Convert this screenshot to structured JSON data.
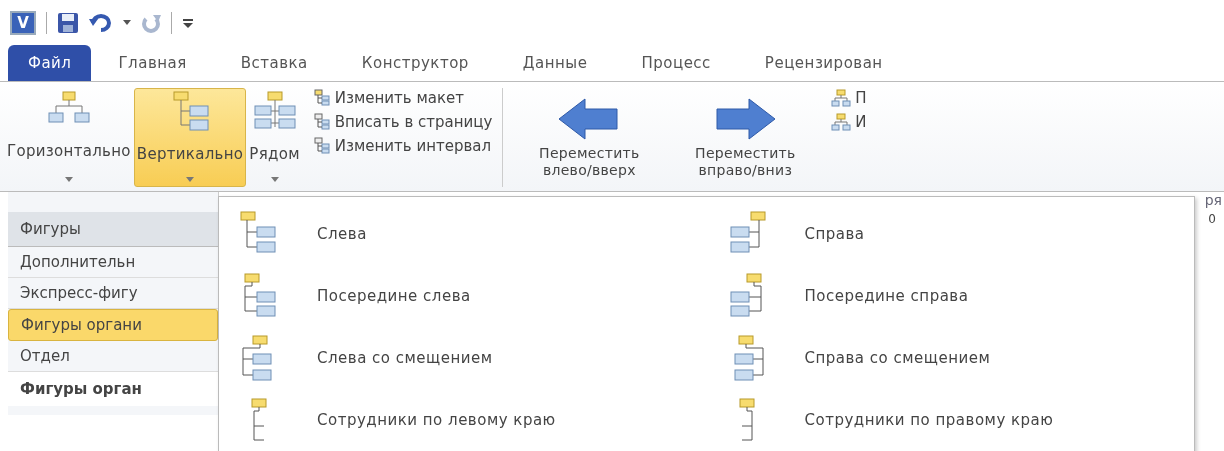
{
  "quick_access": {
    "logo": "V"
  },
  "tabs": [
    {
      "label": "Файл",
      "selected": true
    },
    {
      "label": "Главная",
      "selected": false
    },
    {
      "label": "Вставка",
      "selected": false
    },
    {
      "label": "Конструктор",
      "selected": false
    },
    {
      "label": "Данные",
      "selected": false
    },
    {
      "label": "Процесс",
      "selected": false
    },
    {
      "label": "Рецензирован",
      "selected": false
    }
  ],
  "ribbon": {
    "layout_buttons": [
      {
        "label": "Горизонтально",
        "selected": false,
        "kind": "horizontal"
      },
      {
        "label": "Вертикально",
        "selected": true,
        "kind": "vertical"
      },
      {
        "label": "Рядом",
        "selected": false,
        "kind": "side"
      }
    ],
    "small_buttons": [
      "Изменить макет",
      "Вписать в страницу",
      "Изменить интервал"
    ],
    "move_buttons": [
      {
        "label": "Переместить влево/вверх",
        "kind": "left"
      },
      {
        "label": "Переместить вправо/вниз",
        "kind": "right"
      }
    ],
    "cut_buttons": [
      "П",
      "И"
    ],
    "cut_group_label": "ря"
  },
  "ruler_fragment": "0",
  "shapes_pane": {
    "header": "Фигуры",
    "items": [
      {
        "label": "Дополнительн",
        "selected": false
      },
      {
        "label": "Экспресс-фигу",
        "selected": false
      },
      {
        "label": "Фигуры органи",
        "selected": true
      },
      {
        "label": "Отдел",
        "selected": false
      }
    ],
    "stencil_title": "Фигуры орган"
  },
  "dropdown": {
    "left": [
      {
        "label": "Слева",
        "kind": "top"
      },
      {
        "label": "Посередине слева",
        "kind": "middle"
      },
      {
        "label": "Слева со смещением",
        "kind": "offset"
      },
      {
        "label": "Сотрудники по левому краю",
        "kind": "staff"
      }
    ],
    "right": [
      {
        "label": "Справа",
        "kind": "top"
      },
      {
        "label": "Посередине справа",
        "kind": "middle"
      },
      {
        "label": "Справа со смещением",
        "kind": "offset"
      },
      {
        "label": "Сотрудники по правому краю",
        "kind": "staff"
      }
    ]
  }
}
